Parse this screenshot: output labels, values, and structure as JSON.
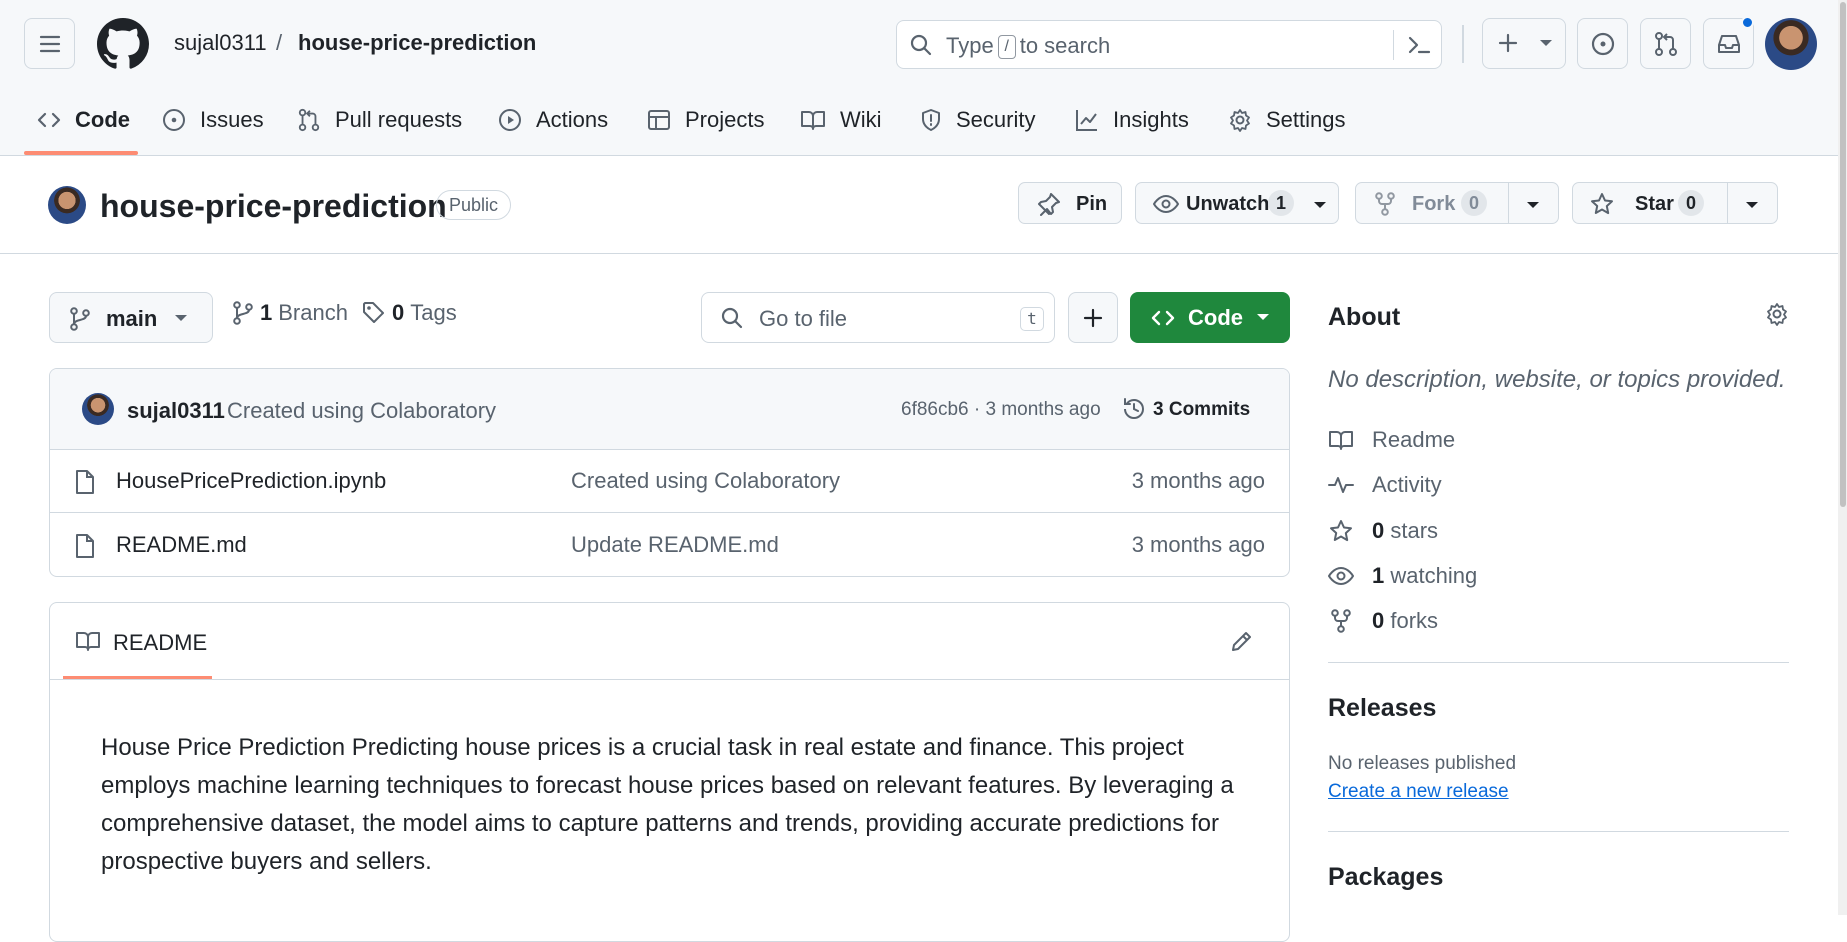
{
  "header": {
    "owner": "sujal0311",
    "separator": "/",
    "repo": "house-price-prediction",
    "search_before": "Type",
    "search_key": "/",
    "search_after": "to search"
  },
  "repo_nav": {
    "tabs": [
      {
        "label": "Code",
        "icon": "code-icon",
        "selected": true
      },
      {
        "label": "Issues",
        "icon": "issue-opened-icon"
      },
      {
        "label": "Pull requests",
        "icon": "git-pull-request-icon"
      },
      {
        "label": "Actions",
        "icon": "play-icon"
      },
      {
        "label": "Projects",
        "icon": "table-icon"
      },
      {
        "label": "Wiki",
        "icon": "book-icon"
      },
      {
        "label": "Security",
        "icon": "shield-icon"
      },
      {
        "label": "Insights",
        "icon": "graph-icon"
      },
      {
        "label": "Settings",
        "icon": "gear-icon"
      }
    ]
  },
  "repo_header": {
    "title": "house-price-prediction",
    "visibility": "Public",
    "pin_label": "Pin",
    "unwatch_label": "Unwatch",
    "watch_count": "1",
    "fork_label": "Fork",
    "fork_count": "0",
    "star_label": "Star",
    "star_count": "0"
  },
  "file_nav": {
    "branch": "main",
    "branch_count": "1",
    "branch_label": "Branch",
    "tag_count": "0",
    "tag_label": "Tags",
    "goto_placeholder": "Go to file",
    "goto_key": "t",
    "code_label": "Code"
  },
  "latest_commit": {
    "author": "sujal0311",
    "message": "Created using Colaboratory",
    "sha_time": "6f86cb6 · 3 months ago",
    "commits_label": "3 Commits"
  },
  "files": [
    {
      "name": "HousePricePrediction.ipynb",
      "message": "Created using Colaboratory",
      "date": "3 months ago"
    },
    {
      "name": "README.md",
      "message": "Update README.md",
      "date": "3 months ago"
    }
  ],
  "readme": {
    "tab_label": "README",
    "paragraph": "House Price Prediction Predicting house prices is a crucial task in real estate and finance. This project employs machine learning techniques to forecast house prices based on relevant features. By leveraging a comprehensive dataset, the model aims to capture patterns and trends, providing accurate predictions for prospective buyers and sellers."
  },
  "about": {
    "heading": "About",
    "description": "No description, website, or topics provided.",
    "readme_label": "Readme",
    "activity_label": "Activity",
    "stars_count": "0",
    "stars_label": "stars",
    "watching_count": "1",
    "watching_label": "watching",
    "forks_count": "0",
    "forks_label": "forks"
  },
  "releases": {
    "heading": "Releases",
    "empty_text": "No releases published",
    "create_link": "Create a new release"
  },
  "packages": {
    "heading": "Packages"
  },
  "colors": {
    "accent": "#fd8c73",
    "primary_button": "#1f883d",
    "link": "#0969da",
    "notification": "#0969da"
  }
}
